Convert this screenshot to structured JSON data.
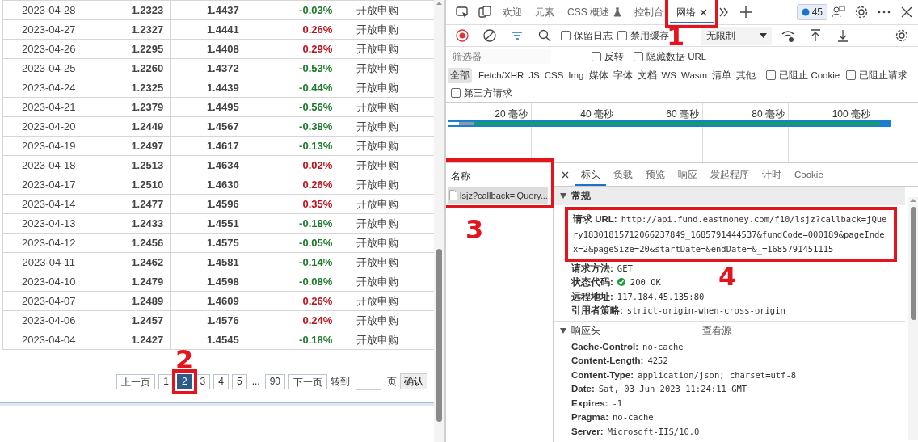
{
  "fund_table": {
    "rows": [
      {
        "date": "2023-04-28",
        "unit_nav": "1.2323",
        "cumulative_nav": "1.4437",
        "daily_growth": "-0.03%",
        "color": "#1c7a2c",
        "status": "开放申购"
      },
      {
        "date": "2023-04-27",
        "unit_nav": "1.2327",
        "cumulative_nav": "1.4441",
        "daily_growth": "0.26%",
        "color": "#c0101a",
        "status": "开放申购"
      },
      {
        "date": "2023-04-26",
        "unit_nav": "1.2295",
        "cumulative_nav": "1.4408",
        "daily_growth": "0.29%",
        "color": "#c0101a",
        "status": "开放申购"
      },
      {
        "date": "2023-04-25",
        "unit_nav": "1.2260",
        "cumulative_nav": "1.4372",
        "daily_growth": "-0.53%",
        "color": "#1c7a2c",
        "status": "开放申购"
      },
      {
        "date": "2023-04-24",
        "unit_nav": "1.2325",
        "cumulative_nav": "1.4439",
        "daily_growth": "-0.44%",
        "color": "#1c7a2c",
        "status": "开放申购"
      },
      {
        "date": "2023-04-21",
        "unit_nav": "1.2379",
        "cumulative_nav": "1.4495",
        "daily_growth": "-0.56%",
        "color": "#1c7a2c",
        "status": "开放申购"
      },
      {
        "date": "2023-04-20",
        "unit_nav": "1.2449",
        "cumulative_nav": "1.4567",
        "daily_growth": "-0.38%",
        "color": "#1c7a2c",
        "status": "开放申购"
      },
      {
        "date": "2023-04-19",
        "unit_nav": "1.2497",
        "cumulative_nav": "1.4617",
        "daily_growth": "-0.13%",
        "color": "#1c7a2c",
        "status": "开放申购"
      },
      {
        "date": "2023-04-18",
        "unit_nav": "1.2513",
        "cumulative_nav": "1.4634",
        "daily_growth": "0.02%",
        "color": "#c0101a",
        "status": "开放申购"
      },
      {
        "date": "2023-04-17",
        "unit_nav": "1.2510",
        "cumulative_nav": "1.4630",
        "daily_growth": "0.26%",
        "color": "#c0101a",
        "status": "开放申购"
      },
      {
        "date": "2023-04-14",
        "unit_nav": "1.2477",
        "cumulative_nav": "1.4596",
        "daily_growth": "0.35%",
        "color": "#c0101a",
        "status": "开放申购"
      },
      {
        "date": "2023-04-13",
        "unit_nav": "1.2433",
        "cumulative_nav": "1.4551",
        "daily_growth": "-0.18%",
        "color": "#1c7a2c",
        "status": "开放申购"
      },
      {
        "date": "2023-04-12",
        "unit_nav": "1.2456",
        "cumulative_nav": "1.4575",
        "daily_growth": "-0.05%",
        "color": "#1c7a2c",
        "status": "开放申购"
      },
      {
        "date": "2023-04-11",
        "unit_nav": "1.2462",
        "cumulative_nav": "1.4581",
        "daily_growth": "-0.14%",
        "color": "#1c7a2c",
        "status": "开放申购"
      },
      {
        "date": "2023-04-10",
        "unit_nav": "1.2479",
        "cumulative_nav": "1.4598",
        "daily_growth": "-0.08%",
        "color": "#1c7a2c",
        "status": "开放申购"
      },
      {
        "date": "2023-04-07",
        "unit_nav": "1.2489",
        "cumulative_nav": "1.4609",
        "daily_growth": "0.26%",
        "color": "#c0101a",
        "status": "开放申购"
      },
      {
        "date": "2023-04-06",
        "unit_nav": "1.2457",
        "cumulative_nav": "1.4576",
        "daily_growth": "0.24%",
        "color": "#c0101a",
        "status": "开放申购"
      },
      {
        "date": "2023-04-04",
        "unit_nav": "1.2427",
        "cumulative_nav": "1.4545",
        "daily_growth": "-0.18%",
        "color": "#1c7a2c",
        "status": "开放申购"
      }
    ]
  },
  "pager": {
    "buttons": [
      {
        "label": "上一页",
        "selected": false
      },
      {
        "label": "1",
        "selected": false
      },
      {
        "label": "2",
        "selected": true,
        "callout": "2"
      },
      {
        "label": "3",
        "selected": false
      },
      {
        "label": "4",
        "selected": false
      },
      {
        "label": "5",
        "selected": false
      },
      {
        "label": "...",
        "kind": "ellipsis"
      },
      {
        "label": "90",
        "selected": false
      },
      {
        "label": "下一页",
        "selected": false
      }
    ],
    "goto_label": "转到",
    "page_label": "页",
    "confirm": "确认"
  },
  "devtools": {
    "tabs": [
      {
        "label": "欢迎",
        "selected": false
      },
      {
        "label": "元素",
        "selected": false
      },
      {
        "label": "CSS 概述",
        "selected": false,
        "experimental": true
      },
      {
        "label": "控制台",
        "selected": false
      },
      {
        "label": "网络",
        "selected": true,
        "closable": true,
        "callout": "1"
      }
    ],
    "issues_count": "45",
    "toolbar": {
      "checkboxes": [
        {
          "label": "保留日志",
          "checked": false
        },
        {
          "label": "禁用缓存",
          "checked": false
        }
      ],
      "throttle": "无限制"
    },
    "filter": {
      "placeholder": "筛选器",
      "checkboxes": [
        {
          "label": "反转",
          "checked": false
        },
        {
          "label": "隐藏数据 URL",
          "checked": false
        }
      ]
    },
    "type_filters": [
      {
        "label": "全部",
        "selected": true
      },
      {
        "label": "Fetch/XHR",
        "selected": false
      },
      {
        "label": "JS",
        "selected": false
      },
      {
        "label": "CSS",
        "selected": false
      },
      {
        "label": "Img",
        "selected": false
      },
      {
        "label": "媒体",
        "selected": false
      },
      {
        "label": "字体",
        "selected": false
      },
      {
        "label": "文档",
        "selected": false
      },
      {
        "label": "WS",
        "selected": false
      },
      {
        "label": "Wasm",
        "selected": false
      },
      {
        "label": "清单",
        "selected": false
      },
      {
        "label": "其他",
        "selected": false
      }
    ],
    "type_checkboxes": [
      {
        "label": "已阻止 Cookie",
        "checked": false
      },
      {
        "label": "已阻止请求",
        "checked": false
      },
      {
        "label": "第三方请求",
        "checked": false
      }
    ],
    "timeline": {
      "ticks": [
        "20 毫秒",
        "40 毫秒",
        "60 毫秒",
        "80 毫秒",
        "100 毫秒"
      ]
    },
    "requests": {
      "header": "名称",
      "callout": "3",
      "items": [
        {
          "name": "lsjz?callback=jQuery...",
          "selected": true
        }
      ]
    },
    "detail_tabs": [
      {
        "label": "标头",
        "selected": true
      },
      {
        "label": "负载",
        "selected": false
      },
      {
        "label": "预览",
        "selected": false
      },
      {
        "label": "响应",
        "selected": false
      },
      {
        "label": "发起程序",
        "selected": false
      },
      {
        "label": "计时",
        "selected": false
      },
      {
        "label": "Cookie",
        "selected": false
      }
    ],
    "sections": [
      {
        "title": "常规",
        "expanded": true,
        "rows": [
          {
            "key": "请求 URL:",
            "value": "http://api.fund.eastmoney.com/f10/lsjz?callback=jQuery18301815712066237849_1685791444537&fundCode=000189&pageIndex=2&pageSize=20&startDate=&endDate=&_=1685791451115",
            "callout": "4"
          },
          {
            "key": "请求方法:",
            "value": "GET"
          },
          {
            "key": "状态代码:",
            "value": "200 OK",
            "kind": "status"
          },
          {
            "key": "远程地址:",
            "value": "117.184.45.135:80"
          },
          {
            "key": "引用者策略:",
            "value": "strict-origin-when-cross-origin"
          }
        ]
      },
      {
        "title": "响应头",
        "expanded": true,
        "action": "查看源",
        "rows": [
          {
            "key": "Cache-Control:",
            "value": "no-cache"
          },
          {
            "key": "Content-Length:",
            "value": "4252"
          },
          {
            "key": "Content-Type:",
            "value": "application/json; charset=utf-8"
          },
          {
            "key": "Date:",
            "value": "Sat, 03 Jun 2023 11:24:11 GMT"
          },
          {
            "key": "Expires:",
            "value": "-1"
          },
          {
            "key": "Pragma:",
            "value": "no-cache"
          },
          {
            "key": "Server:",
            "value": "Microsoft-IIS/10.0"
          }
        ]
      }
    ]
  }
}
